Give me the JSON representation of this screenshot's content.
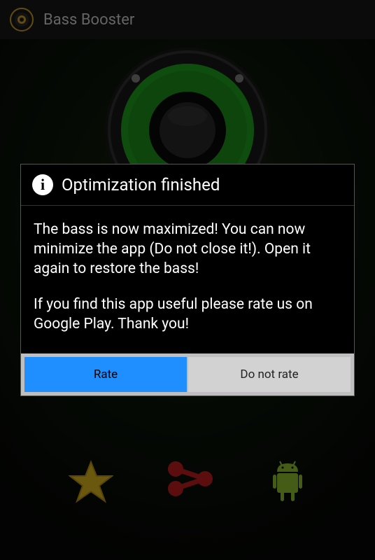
{
  "header": {
    "title": "Bass Booster"
  },
  "dialog": {
    "title": "Optimization finished",
    "paragraph1": "The bass is now maximized! You can now minimize the app (Do not close it!). Open it again to restore the bass!",
    "paragraph2": "If you find this app useful please rate us on Google Play. Thank you!",
    "rate_label": "Rate",
    "no_rate_label": "Do not rate"
  }
}
